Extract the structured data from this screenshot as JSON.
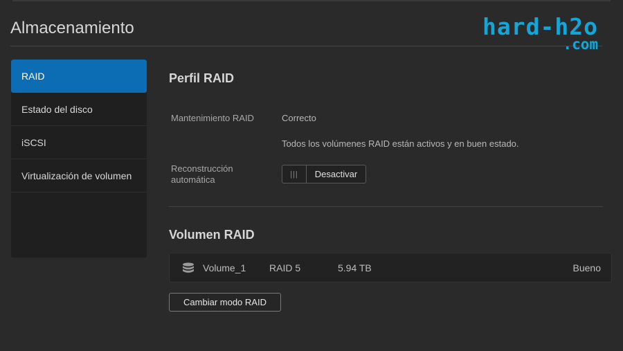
{
  "header": {
    "title": "Almacenamiento"
  },
  "logo": {
    "main": "hard-h2o",
    "sub": ".com"
  },
  "sidebar": {
    "items": [
      {
        "label": "RAID",
        "active": true
      },
      {
        "label": "Estado del disco",
        "active": false
      },
      {
        "label": "iSCSI",
        "active": false
      },
      {
        "label": "Virtualización de volumen",
        "active": false
      }
    ]
  },
  "raid_profile": {
    "title": "Perfil RAID",
    "maintenance_label": "Mantenimiento RAID",
    "maintenance_value": "Correcto",
    "maintenance_detail": "Todos los volúmenes RAID están activos y en buen estado.",
    "rebuild_label_line1": "Reconstrucción",
    "rebuild_label_line2": "automática",
    "toggle_handle": "|||",
    "toggle_label": "Desactivar"
  },
  "raid_volume": {
    "title": "Volumen RAID",
    "volumes": [
      {
        "name": "Volume_1",
        "raid": "RAID 5",
        "size": "5.94 TB",
        "status": "Bueno"
      }
    ],
    "change_mode_button": "Cambiar modo RAID"
  },
  "colors": {
    "accent": "#0c6db5",
    "logo": "#12a6d9",
    "background": "#2a2a2a"
  },
  "icons": {
    "volume": "database-icon"
  }
}
